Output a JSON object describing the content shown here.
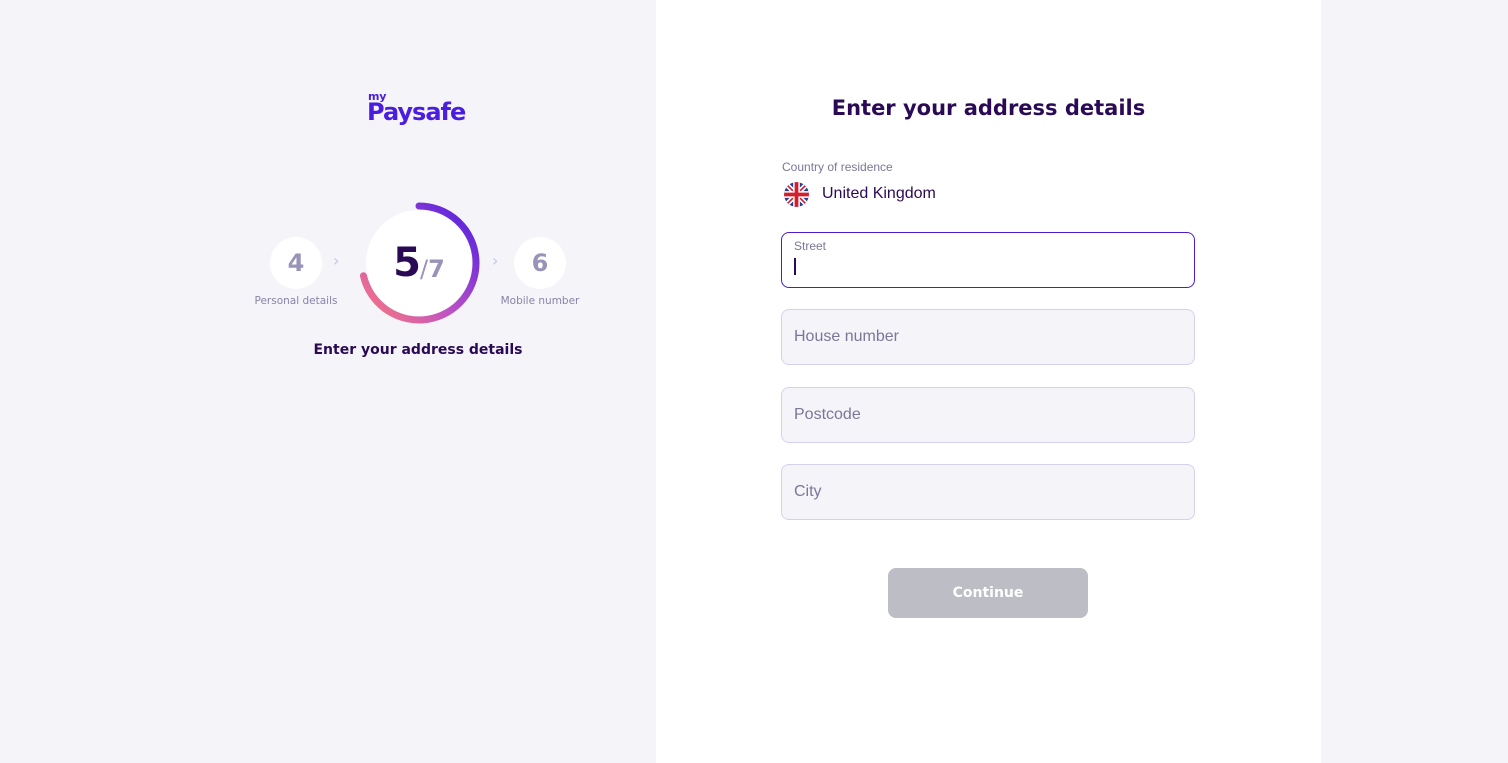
{
  "brand": {
    "logo_prefix": "my",
    "logo_name": "Paysafe",
    "color": "#4a1de0"
  },
  "stepper": {
    "previous": {
      "number": "4",
      "label": "Personal details"
    },
    "current": {
      "number": "5",
      "separator": "/",
      "total": "7",
      "progress_fraction": 0.714
    },
    "next": {
      "number": "6",
      "label": "Mobile number"
    },
    "current_title": "Enter your address details"
  },
  "form": {
    "title": "Enter your address details",
    "country": {
      "label": "Country of residence",
      "value": "United Kingdom",
      "flag_icon": "uk-flag-icon"
    },
    "fields": {
      "street": {
        "label": "Street",
        "value": "",
        "placeholder": ""
      },
      "house_number": {
        "placeholder": "House number",
        "value": ""
      },
      "postcode": {
        "placeholder": "Postcode",
        "value": ""
      },
      "city": {
        "placeholder": "City",
        "value": ""
      }
    },
    "continue_label": "Continue",
    "continue_disabled": true
  },
  "colors": {
    "primary_text": "#2a0a55",
    "accent": "#4a1dd0",
    "muted": "#7d7698",
    "button_disabled": "#bdbdc5",
    "ring_gradient_start": "#ff7a7a",
    "ring_gradient_end": "#4a1de0"
  }
}
